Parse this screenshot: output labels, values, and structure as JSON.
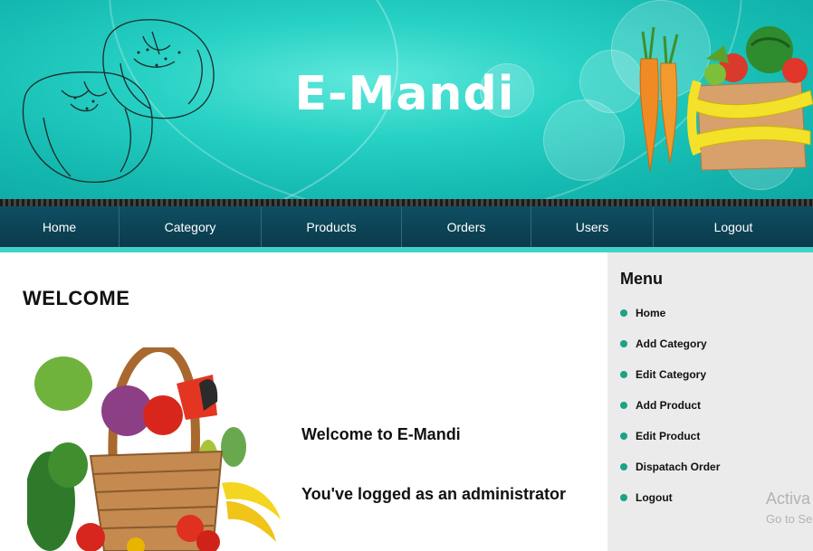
{
  "header": {
    "title": "E-Mandi"
  },
  "nav": {
    "items": [
      "Home",
      "Category",
      "Products",
      "Orders",
      "Users",
      "Logout"
    ]
  },
  "main": {
    "heading": "WELCOME",
    "welcome_line": "Welcome to E-Mandi",
    "admin_line": "You've logged as an administrator"
  },
  "sidebar": {
    "title": "Menu",
    "items": [
      "Home",
      "Add Category",
      "Edit Category",
      "Add Product",
      "Edit Product",
      "Dispatach Order",
      "Logout"
    ]
  },
  "watermark": {
    "line1": "Activa",
    "line2": "Go to Se"
  },
  "colors": {
    "banner": "#27d1c4",
    "nav": "#0b3a4b",
    "nav_accent": "#3fd3c6",
    "bullet": "#1aa385",
    "sidebar": "#ebebeb"
  }
}
